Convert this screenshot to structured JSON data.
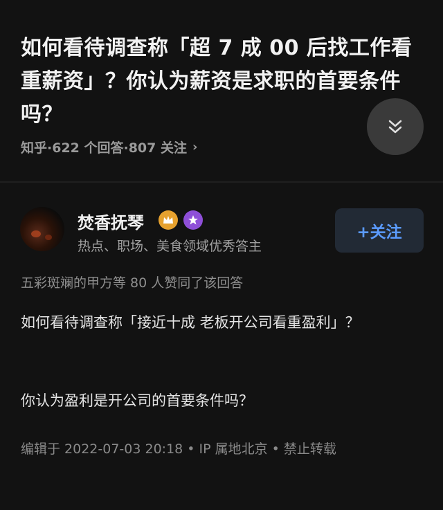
{
  "question": {
    "title": "如何看待调查称「超 7 成 00 后找工作看重薪资」？你认为薪资是求职的首要条件吗？",
    "meta": "知乎·622 个回答·807 关注",
    "chevron_icon": "chevron-right-icon",
    "collapse_icon": "double-chevron-down-icon"
  },
  "answer": {
    "author_name": "焚香抚琴",
    "author_desc": "热点、职场、美食领域优秀答主",
    "follow_label": "+关注",
    "upvote_text": "五彩斑斓的甲方等 80 人赞同了该回答",
    "paragraphs": [
      "如何看待调查称「接近十成 老板开公司看重盈利」？",
      "你认为盈利是开公司的首要条件吗？"
    ],
    "footer": "编辑于 2022-07-03 20:18 • IP 属地北京 • 禁止转载"
  },
  "colors": {
    "background": "#121212",
    "accent_blue": "#5b9bff",
    "crown_badge": "#e6a12e",
    "star_badge": "#8e4fd8"
  }
}
